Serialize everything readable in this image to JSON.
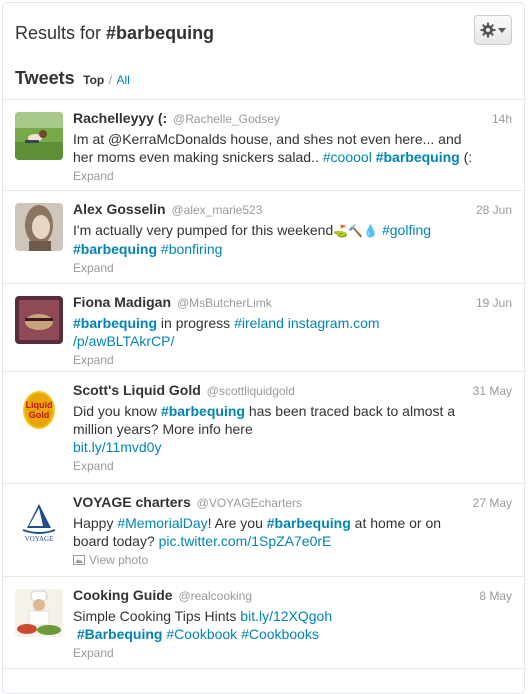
{
  "header": {
    "results_prefix": "Results for",
    "query": "#barbequing",
    "tweets_label": "Tweets",
    "top_label": "Top",
    "separator": "/",
    "all_label": "All"
  },
  "tweets": [
    {
      "name": "Rachelleyyy (:",
      "handle": "@Rachelle_Godsey",
      "time": "14h",
      "text1": "Im at @KerraMcDonalds house, and shes not even here... and",
      "text2a": "her moms even making snickers salad.. ",
      "tag1": "#cooool",
      "tag2": "#barbequing",
      "text2b": " (:",
      "action": "Expand"
    },
    {
      "name": "Alex Gosselin",
      "handle": "@alex_marie523",
      "time": "28 Jun",
      "text1a": "I'm actually very pumped for this weekend",
      "emoji": "⛳🔨💧",
      "tag1": "#golfing",
      "tag2": "#barbequing",
      "tag3": "#bonfiring",
      "action": "Expand"
    },
    {
      "name": "Fiona Madigan",
      "handle": "@MsButcherLimk",
      "time": "19 Jun",
      "tag1": "#barbequing",
      "text1": " in progress ",
      "tag2": "#ireland",
      "link1": "instagram.com",
      "link2": "/p/awBLTAkrCP/",
      "action": "Expand"
    },
    {
      "name": "Scott's Liquid Gold",
      "handle": "@scottliquidgold",
      "time": "31 May",
      "text1a": "Did you know ",
      "tag1": "#barbequing",
      "text1b": " has been traced back to almost a",
      "text2": "million years? More info here",
      "link1": "bit.ly/11mvd0y",
      "action": "Expand",
      "logo_top": "Liquid",
      "logo_bottom": "Gold"
    },
    {
      "name": "VOYAGE charters",
      "handle": "@VOYAGEcharters",
      "time": "27 May",
      "text1a": "Happy ",
      "tag1": "#MemorialDay",
      "text1b": "! Are you ",
      "tag2": "#barbequing",
      "text1c": " at home or on",
      "text2": "board today? ",
      "link1": "pic.twitter.com/1SpZA7e0rE",
      "action": "View photo",
      "logo_text": "VOYAGE"
    },
    {
      "name": "Cooking Guide",
      "handle": "@realcooking",
      "time": "8 May",
      "text1": "Simple Cooking Tips Hints ",
      "link1": "bit.ly/12XQgoh",
      "tag1": "#Barbequing",
      "tag2": "#Cookbook",
      "tag3": "#Cookbooks",
      "action": "Expand"
    }
  ],
  "colors": {
    "link": "#0084b4",
    "muted": "#999999",
    "text": "#333333",
    "border": "#e8e8e8"
  },
  "icons": [
    "gear-icon",
    "chevron-down-icon",
    "photo-icon"
  ]
}
